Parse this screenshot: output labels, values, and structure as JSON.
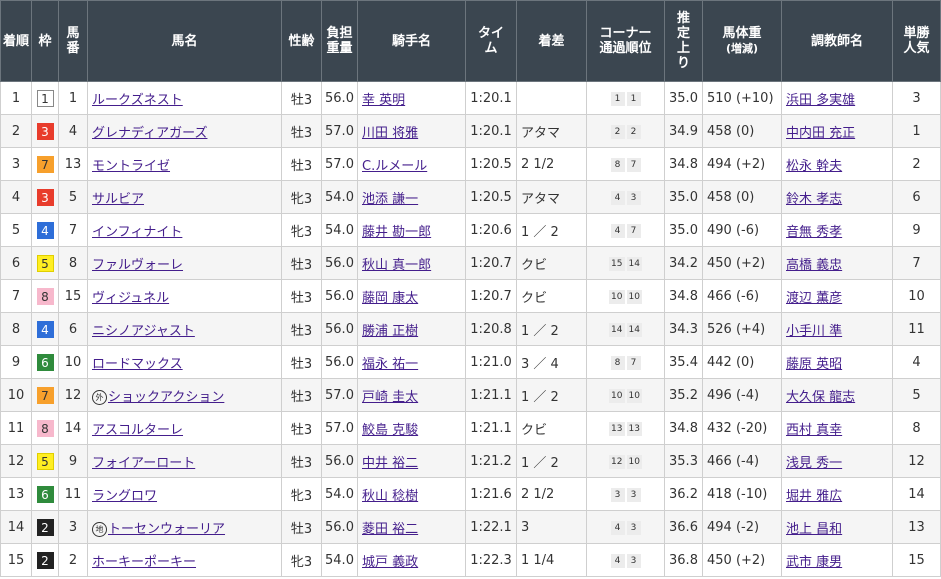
{
  "headers": {
    "rank": "着順",
    "waku": "枠",
    "umaban": "馬番",
    "horse": "馬名",
    "sexage": "性齢",
    "weight": "負担重量",
    "jockey": "騎手名",
    "time": "タイム",
    "margin": "着差",
    "corner": "コーナー通過順位",
    "last3f": "推定上り",
    "bodyweight": "馬体重",
    "bodyweight_sub": "(増減)",
    "trainer": "調教師名",
    "pop": "単勝人気"
  },
  "rows": [
    {
      "rank": "1",
      "waku": "1",
      "umaban": "1",
      "mark": "",
      "horse": "ルークズネスト",
      "sexage": "牡3",
      "weight": "56.0",
      "jockey": "幸 英明",
      "time": "1:20.1",
      "margin": "",
      "corner": [
        "1",
        "1"
      ],
      "last3f": "35.0",
      "bodyweight": "510 (+10)",
      "trainer": "浜田 多実雄",
      "pop": "3"
    },
    {
      "rank": "2",
      "waku": "3",
      "umaban": "4",
      "mark": "",
      "horse": "グレナディアガーズ",
      "sexage": "牡3",
      "weight": "57.0",
      "jockey": "川田 将雅",
      "time": "1:20.1",
      "margin": "アタマ",
      "corner": [
        "2",
        "2"
      ],
      "last3f": "34.9",
      "bodyweight": "458 (0)",
      "trainer": "中内田 充正",
      "pop": "1"
    },
    {
      "rank": "3",
      "waku": "7",
      "umaban": "13",
      "mark": "",
      "horse": "モントライゼ",
      "sexage": "牡3",
      "weight": "57.0",
      "jockey": "C.ルメール",
      "time": "1:20.5",
      "margin": "2 1/2",
      "corner": [
        "8",
        "7"
      ],
      "last3f": "34.8",
      "bodyweight": "494 (+2)",
      "trainer": "松永 幹夫",
      "pop": "2"
    },
    {
      "rank": "4",
      "waku": "3",
      "umaban": "5",
      "mark": "",
      "horse": "サルビア",
      "sexage": "牝3",
      "weight": "54.0",
      "jockey": "池添 謙一",
      "time": "1:20.5",
      "margin": "アタマ",
      "corner": [
        "4",
        "3"
      ],
      "last3f": "35.0",
      "bodyweight": "458 (0)",
      "trainer": "鈴木 孝志",
      "pop": "6"
    },
    {
      "rank": "5",
      "waku": "4",
      "umaban": "7",
      "mark": "",
      "horse": "インフィナイト",
      "sexage": "牝3",
      "weight": "54.0",
      "jockey": "藤井 勘一郎",
      "time": "1:20.6",
      "margin": "1 ／ 2",
      "corner": [
        "4",
        "7"
      ],
      "last3f": "35.0",
      "bodyweight": "490 (-6)",
      "trainer": "音無 秀孝",
      "pop": "9"
    },
    {
      "rank": "6",
      "waku": "5",
      "umaban": "8",
      "mark": "",
      "horse": "ファルヴォーレ",
      "sexage": "牡3",
      "weight": "56.0",
      "jockey": "秋山 真一郎",
      "time": "1:20.7",
      "margin": "クビ",
      "corner": [
        "15",
        "14"
      ],
      "last3f": "34.2",
      "bodyweight": "450 (+2)",
      "trainer": "高橋 義忠",
      "pop": "7"
    },
    {
      "rank": "7",
      "waku": "8",
      "umaban": "15",
      "mark": "",
      "horse": "ヴィジュネル",
      "sexage": "牡3",
      "weight": "56.0",
      "jockey": "藤岡 康太",
      "time": "1:20.7",
      "margin": "クビ",
      "corner": [
        "10",
        "10"
      ],
      "last3f": "34.8",
      "bodyweight": "466 (-6)",
      "trainer": "渡辺 薫彦",
      "pop": "10"
    },
    {
      "rank": "8",
      "waku": "4",
      "umaban": "6",
      "mark": "",
      "horse": "ニシノアジャスト",
      "sexage": "牡3",
      "weight": "56.0",
      "jockey": "勝浦 正樹",
      "time": "1:20.8",
      "margin": "1 ／ 2",
      "corner": [
        "14",
        "14"
      ],
      "last3f": "34.3",
      "bodyweight": "526 (+4)",
      "trainer": "小手川 準",
      "pop": "11"
    },
    {
      "rank": "9",
      "waku": "6",
      "umaban": "10",
      "mark": "",
      "horse": "ロードマックス",
      "sexage": "牡3",
      "weight": "56.0",
      "jockey": "福永 祐一",
      "time": "1:21.0",
      "margin": "3 ／ 4",
      "corner": [
        "8",
        "7"
      ],
      "last3f": "35.4",
      "bodyweight": "442 (0)",
      "trainer": "藤原 英昭",
      "pop": "4"
    },
    {
      "rank": "10",
      "waku": "7",
      "umaban": "12",
      "mark": "外",
      "horse": "ショックアクション",
      "sexage": "牡3",
      "weight": "57.0",
      "jockey": "戸崎 圭太",
      "time": "1:21.1",
      "margin": "1 ／ 2",
      "corner": [
        "10",
        "10"
      ],
      "last3f": "35.2",
      "bodyweight": "496 (-4)",
      "trainer": "大久保 龍志",
      "pop": "5"
    },
    {
      "rank": "11",
      "waku": "8",
      "umaban": "14",
      "mark": "",
      "horse": "アスコルターレ",
      "sexage": "牡3",
      "weight": "57.0",
      "jockey": "鮫島 克駿",
      "time": "1:21.1",
      "margin": "クビ",
      "corner": [
        "13",
        "13"
      ],
      "last3f": "34.8",
      "bodyweight": "432 (-20)",
      "trainer": "西村 真幸",
      "pop": "8"
    },
    {
      "rank": "12",
      "waku": "5",
      "umaban": "9",
      "mark": "",
      "horse": "フォイアーロート",
      "sexage": "牡3",
      "weight": "56.0",
      "jockey": "中井 裕二",
      "time": "1:21.2",
      "margin": "1 ／ 2",
      "corner": [
        "12",
        "10"
      ],
      "last3f": "35.3",
      "bodyweight": "466 (-4)",
      "trainer": "浅見 秀一",
      "pop": "12"
    },
    {
      "rank": "13",
      "waku": "6",
      "umaban": "11",
      "mark": "",
      "horse": "ラングロワ",
      "sexage": "牝3",
      "weight": "54.0",
      "jockey": "秋山 稔樹",
      "time": "1:21.6",
      "margin": "2 1/2",
      "corner": [
        "3",
        "3"
      ],
      "last3f": "36.2",
      "bodyweight": "418 (-10)",
      "trainer": "堀井 雅広",
      "pop": "14"
    },
    {
      "rank": "14",
      "waku": "2",
      "umaban": "3",
      "mark": "地",
      "horse": "トーセンウォーリア",
      "sexage": "牡3",
      "weight": "56.0",
      "jockey": "菱田 裕二",
      "time": "1:22.1",
      "margin": "3",
      "corner": [
        "4",
        "3"
      ],
      "last3f": "36.6",
      "bodyweight": "494 (-2)",
      "trainer": "池上 昌和",
      "pop": "13"
    },
    {
      "rank": "15",
      "waku": "2",
      "umaban": "2",
      "mark": "",
      "horse": "ホーキーポーキー",
      "sexage": "牝3",
      "weight": "54.0",
      "jockey": "城戸 義政",
      "time": "1:22.3",
      "margin": "1 1/4",
      "corner": [
        "4",
        "3"
      ],
      "last3f": "36.8",
      "bodyweight": "450 (+2)",
      "trainer": "武市 康男",
      "pop": "15"
    }
  ],
  "waku_colors": {
    "1": {
      "bg": "#ffffff",
      "fg": "#333333",
      "border": "#888888"
    },
    "2": {
      "bg": "#222222",
      "fg": "#ffffff",
      "border": "#222222"
    },
    "3": {
      "bg": "#e83c2c",
      "fg": "#ffffff",
      "border": "#e83c2c"
    },
    "4": {
      "bg": "#2e6ed8",
      "fg": "#ffffff",
      "border": "#2e6ed8"
    },
    "5": {
      "bg": "#ffee22",
      "fg": "#333333",
      "border": "#e0cf00"
    },
    "6": {
      "bg": "#2f8b3c",
      "fg": "#ffffff",
      "border": "#2f8b3c"
    },
    "7": {
      "bg": "#f7a02c",
      "fg": "#333333",
      "border": "#f7a02c"
    },
    "8": {
      "bg": "#f7b8cc",
      "fg": "#333333",
      "border": "#f7b8cc"
    }
  },
  "colors": {
    "header_bg": "#3b4650",
    "link": "#441e8c",
    "row_alt": "#f5f5f5"
  }
}
